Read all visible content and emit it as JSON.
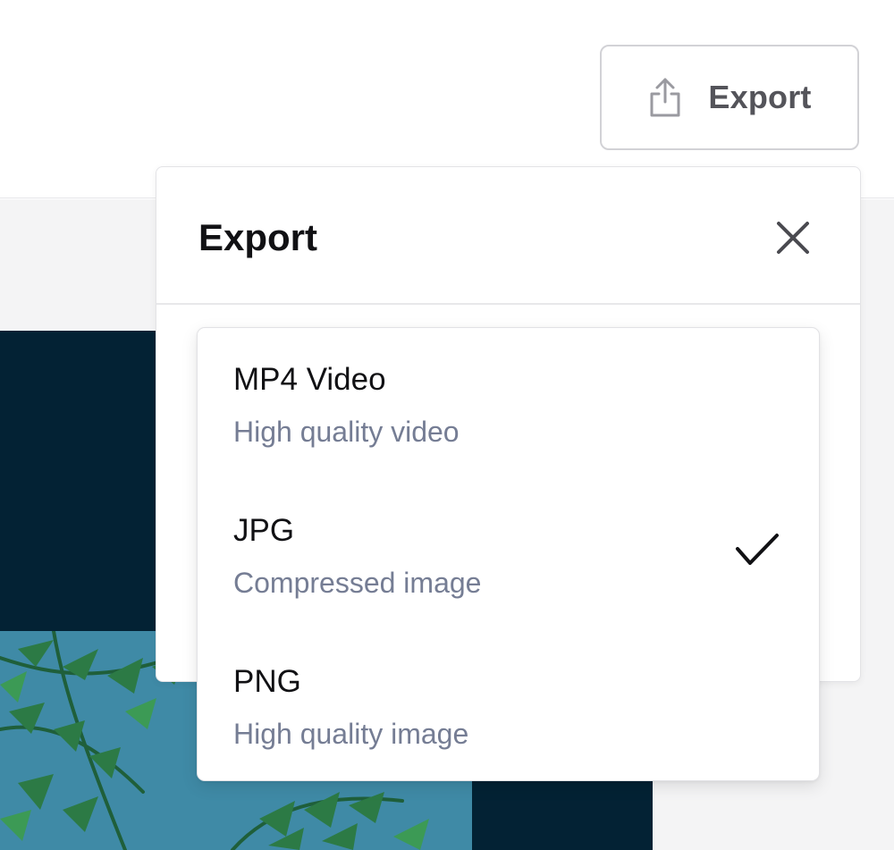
{
  "header": {
    "export_button": {
      "label": "Export",
      "icon": "share-upload-icon"
    }
  },
  "export_panel": {
    "title": "Export",
    "close_icon": "close-icon",
    "options": [
      {
        "title": "MP4 Video",
        "description": "High quality video",
        "selected": false
      },
      {
        "title": "JPG",
        "description": "Compressed image",
        "selected": true
      },
      {
        "title": "PNG",
        "description": "High quality image",
        "selected": false
      }
    ],
    "selected_icon": "checkmark-icon"
  },
  "colors": {
    "canvas_background": "#032234",
    "photo_background": "#3f8aa6",
    "workspace_background": "#f4f4f5",
    "description_text": "#757d94"
  }
}
